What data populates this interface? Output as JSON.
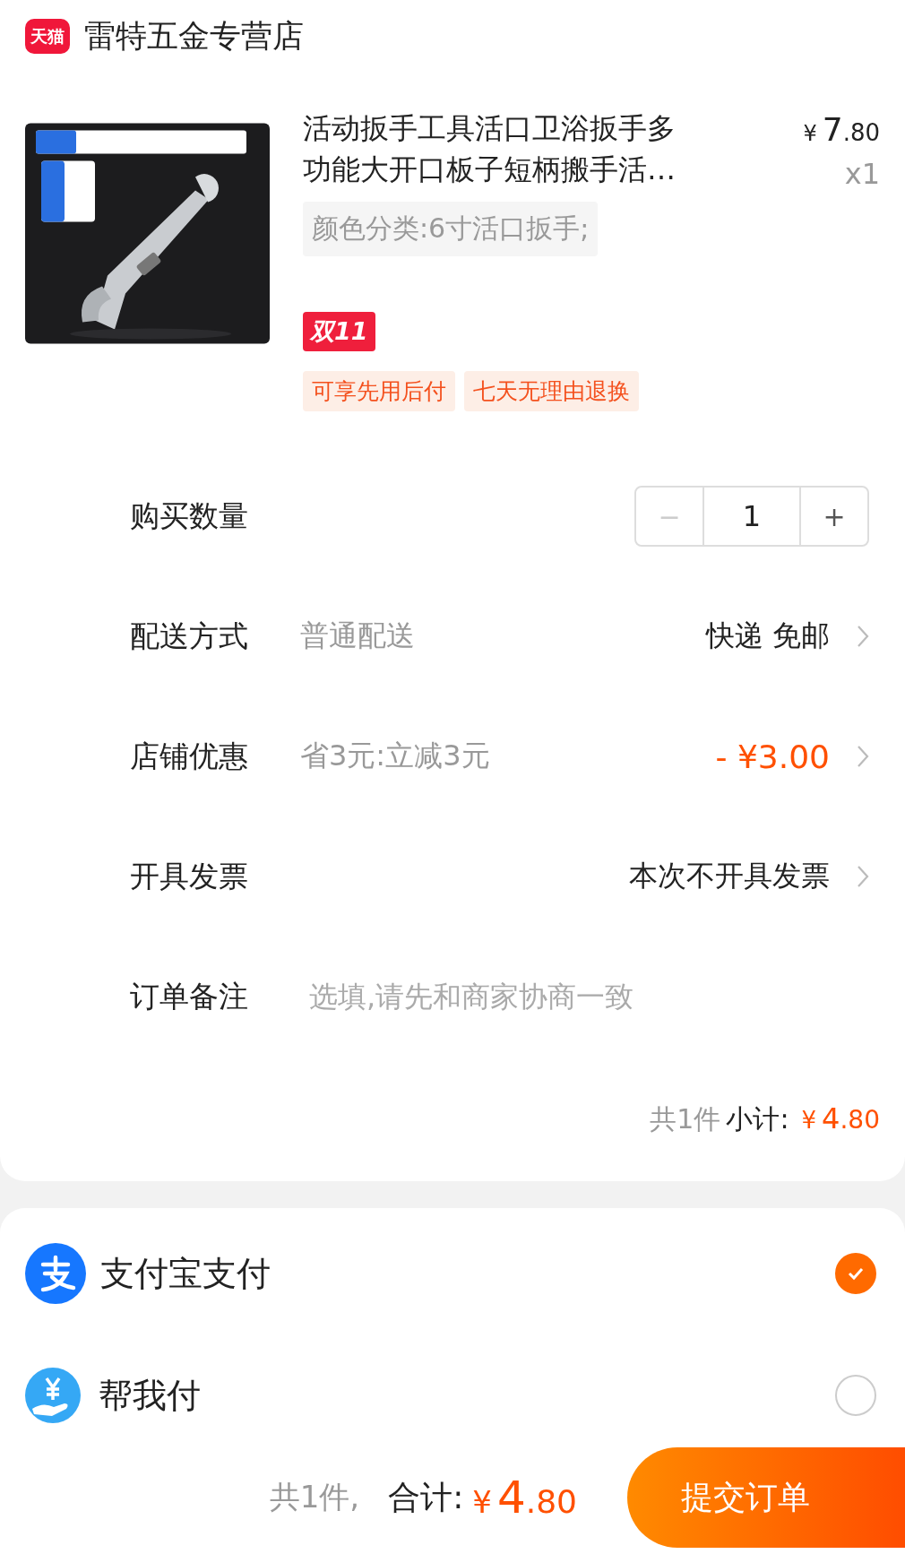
{
  "shop": {
    "badge": "天猫",
    "name": "雷特五金专营店"
  },
  "product": {
    "title": "活动扳手工具活口卫浴扳手多功能大开口板子短柄搬手活…",
    "price": {
      "currency": "¥",
      "whole": "7",
      "fraction": ".80"
    },
    "quantity": "x1",
    "spec": "颜色分类:6寸活口扳手;",
    "promo_badge": "双11",
    "tags": [
      "可享先用后付",
      "七天无理由退换"
    ]
  },
  "rows": [
    {
      "kind": "stepper",
      "label": "购买数量",
      "minus": "−",
      "value": "1",
      "plus": "+",
      "minus_disabled": true
    },
    {
      "kind": "select",
      "label": "配送方式",
      "detail": "普通配送",
      "value": "快递 免邮"
    },
    {
      "kind": "discount",
      "label": "店铺优惠",
      "detail": "省3元:立减3元",
      "value": "- ¥3.00"
    },
    {
      "kind": "select",
      "label": "开具发票",
      "value": "本次不开具发票"
    },
    {
      "kind": "note",
      "label": "订单备注",
      "placeholder": "选填,请先和商家协商一致"
    }
  ],
  "subtotal": {
    "count": "共1件",
    "label": "小计:",
    "currency": "¥",
    "whole": "4",
    "fraction": ".80"
  },
  "payments": [
    {
      "kind": "alipay",
      "label": "支付宝支付",
      "selected": true
    },
    {
      "kind": "helper",
      "label": "帮我付",
      "selected": false
    }
  ],
  "footer": {
    "count": "共1件,",
    "label": "合计:",
    "currency": "¥",
    "whole": "4",
    "fraction": ".80",
    "submit": "提交订单"
  }
}
